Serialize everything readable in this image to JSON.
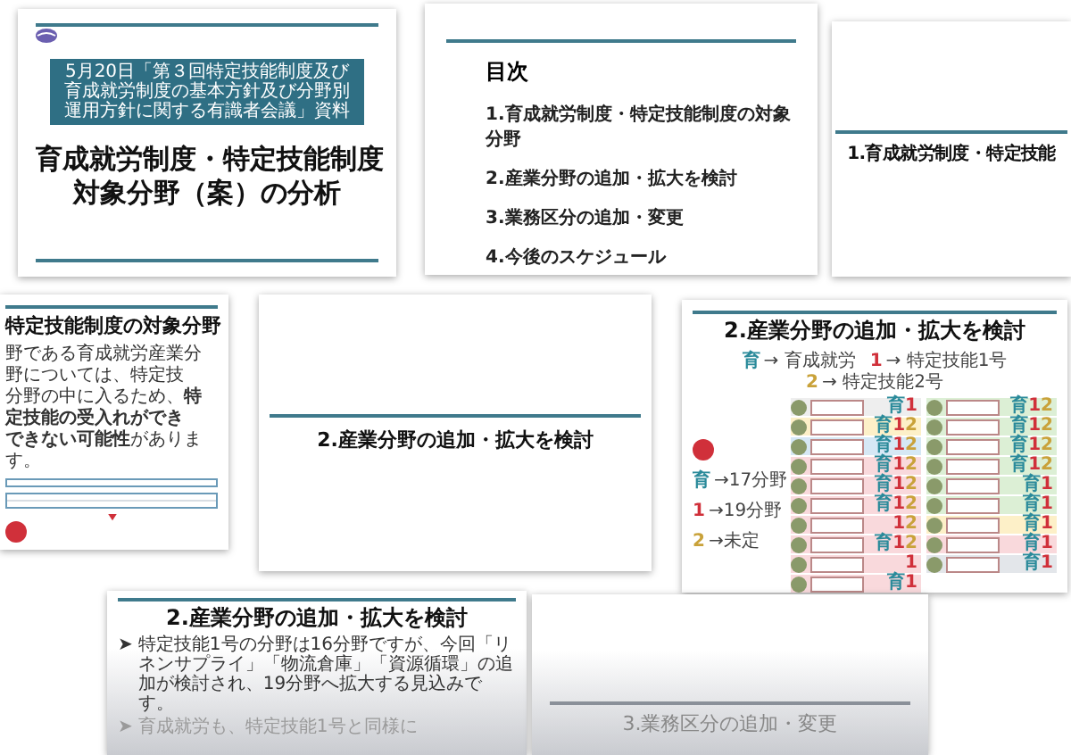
{
  "slides": [
    {
      "kind": "title",
      "subtitle": "5月20日「第３回特定技能制度及び育成就労制度の基本方針及び分野別運用方針に関する有識者会議」資料",
      "title_lines": [
        "育成就労制度・特定技能制度",
        "対象分野（案）の分析"
      ]
    },
    {
      "kind": "toc",
      "heading": "目次",
      "items": [
        "1.育成就労制度・特定技能制度の対象分野",
        "2.産業分野の追加・拡大を検討",
        "3.業務区分の追加・変更",
        "4.今後のスケジュール"
      ]
    },
    {
      "kind": "section",
      "title": "1.育成就労制度・特定技能"
    },
    {
      "kind": "text",
      "title": "特定技能制度の対象分野",
      "lines": [
        "野である育成就労産業分野については、特定技",
        "分野の中に入るため、**特定技能の受入れができ**",
        "**できない可能性**があります。"
      ]
    },
    {
      "kind": "section",
      "title": "2.産業分野の追加・拡大を検討"
    },
    {
      "kind": "chart",
      "title": "2.産業分野の追加・拡大を検討",
      "legend": [
        {
          "mark": {
            "kind": "ikusei",
            "text": "育"
          },
          "label": "→ 育成就労"
        },
        {
          "mark": {
            "kind": "tokutei1",
            "text": "1"
          },
          "label": "→ 特定技能1号"
        },
        {
          "mark": {
            "kind": "tokutei2",
            "text": "2"
          },
          "label": "→ 特定技能2号"
        }
      ],
      "summary": [
        {
          "mark": {
            "kind": "ikusei",
            "text": "育"
          },
          "label": "→17分野"
        },
        {
          "mark": {
            "kind": "tokutei1",
            "text": "1"
          },
          "label": "→19分野"
        },
        {
          "mark": {
            "kind": "tokutei2",
            "text": "2"
          },
          "label": "→未定"
        }
      ],
      "columns": [
        [
          {
            "color": "#eeeeee",
            "marks": [
              {
                "kind": "ikusei",
                "text": "育"
              },
              {
                "kind": "tokutei1",
                "text": "1"
              }
            ]
          },
          {
            "color": "#fdf0c8",
            "marks": [
              {
                "kind": "ikusei",
                "text": "育"
              },
              {
                "kind": "tokutei1",
                "text": "1"
              },
              {
                "kind": "tokutei2",
                "text": "2"
              }
            ]
          },
          {
            "color": "#d6e8f5",
            "marks": [
              {
                "kind": "ikusei",
                "text": "育"
              },
              {
                "kind": "tokutei1",
                "text": "1"
              },
              {
                "kind": "tokutei2",
                "text": "2"
              }
            ]
          },
          {
            "color": "#f9d9dc",
            "marks": [
              {
                "kind": "ikusei",
                "text": "育"
              },
              {
                "kind": "tokutei1",
                "text": "1"
              },
              {
                "kind": "tokutei2",
                "text": "2"
              }
            ]
          },
          {
            "color": "#f9d9dc",
            "marks": [
              {
                "kind": "ikusei",
                "text": "育"
              },
              {
                "kind": "tokutei1",
                "text": "1"
              },
              {
                "kind": "tokutei2",
                "text": "2"
              }
            ]
          },
          {
            "color": "#f9d9dc",
            "marks": [
              {
                "kind": "ikusei",
                "text": "育"
              },
              {
                "kind": "tokutei1",
                "text": "1"
              },
              {
                "kind": "tokutei2",
                "text": "2"
              }
            ]
          },
          {
            "color": "#f9d9dc",
            "marks": [
              {
                "kind": "tokutei1",
                "text": "1"
              },
              {
                "kind": "tokutei2",
                "text": "2"
              }
            ]
          },
          {
            "color": "#f9d9dc",
            "marks": [
              {
                "kind": "ikusei",
                "text": "育"
              },
              {
                "kind": "tokutei1",
                "text": "1"
              },
              {
                "kind": "tokutei2",
                "text": "2"
              }
            ]
          },
          {
            "color": "#f9d9dc",
            "marks": [
              {
                "kind": "tokutei1",
                "text": "1"
              }
            ]
          },
          {
            "color": "#f9d9dc",
            "marks": [
              {
                "kind": "ikusei",
                "text": "育"
              },
              {
                "kind": "tokutei1",
                "text": "1"
              }
            ]
          }
        ],
        [
          {
            "color": "#dcefd5",
            "marks": [
              {
                "kind": "ikusei",
                "text": "育"
              },
              {
                "kind": "tokutei1",
                "text": "1"
              },
              {
                "kind": "tokutei2",
                "text": "2"
              }
            ]
          },
          {
            "color": "#dcefd5",
            "marks": [
              {
                "kind": "ikusei",
                "text": "育"
              },
              {
                "kind": "tokutei1",
                "text": "1"
              },
              {
                "kind": "tokutei2",
                "text": "2"
              }
            ]
          },
          {
            "color": "#dcefd5",
            "marks": [
              {
                "kind": "ikusei",
                "text": "育"
              },
              {
                "kind": "tokutei1",
                "text": "1"
              },
              {
                "kind": "tokutei2",
                "text": "2"
              }
            ]
          },
          {
            "color": "#dcefd5",
            "marks": [
              {
                "kind": "ikusei",
                "text": "育"
              },
              {
                "kind": "tokutei1",
                "text": "1"
              },
              {
                "kind": "tokutei2",
                "text": "2"
              }
            ]
          },
          {
            "color": "#dcefd5",
            "marks": [
              {
                "kind": "ikusei",
                "text": "育"
              },
              {
                "kind": "tokutei1",
                "text": "1"
              }
            ]
          },
          {
            "color": "#dcefd5",
            "marks": [
              {
                "kind": "ikusei",
                "text": "育"
              },
              {
                "kind": "tokutei1",
                "text": "1"
              }
            ]
          },
          {
            "color": "#fdf0c8",
            "marks": [
              {
                "kind": "ikusei",
                "text": "育"
              },
              {
                "kind": "tokutei1",
                "text": "1"
              }
            ]
          },
          {
            "color": "#f9d9dc",
            "marks": [
              {
                "kind": "ikusei",
                "text": "育"
              },
              {
                "kind": "tokutei1",
                "text": "1"
              }
            ]
          },
          {
            "color": "#e3e6ea",
            "marks": [
              {
                "kind": "ikusei",
                "text": "育"
              },
              {
                "kind": "tokutei1",
                "text": "1"
              }
            ]
          }
        ]
      ]
    },
    {
      "kind": "bullets",
      "title": "2.産業分野の追加・拡大を検討",
      "bullets": [
        {
          "marker": "➤",
          "text": "特定技能1号の分野は16分野ですが、今回「リネンサプライ」「物流倉庫」「資源循環」の追加が検討され、19分野へ拡大する見込みです。",
          "faded": false
        },
        {
          "marker": "➤",
          "text": "育成就労も、特定技能1号と同様に",
          "faded": true
        }
      ]
    },
    {
      "kind": "footer",
      "title": "3.業務区分の追加・変更"
    }
  ]
}
